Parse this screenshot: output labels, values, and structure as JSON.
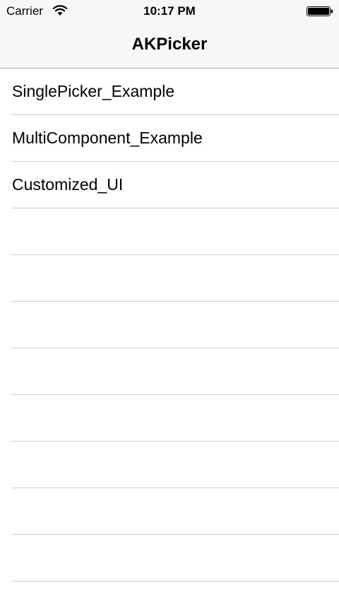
{
  "status_bar": {
    "carrier": "Carrier",
    "time": "10:17 PM",
    "wifi_icon": "wifi-icon",
    "battery_icon": "battery-icon"
  },
  "nav": {
    "title": "AKPicker"
  },
  "table": {
    "rows": [
      {
        "label": "SinglePicker_Example"
      },
      {
        "label": "MultiComponent_Example"
      },
      {
        "label": "Customized_UI"
      },
      {
        "label": ""
      },
      {
        "label": ""
      },
      {
        "label": ""
      },
      {
        "label": ""
      },
      {
        "label": ""
      },
      {
        "label": ""
      },
      {
        "label": ""
      },
      {
        "label": ""
      },
      {
        "label": ""
      }
    ]
  },
  "colors": {
    "nav_background": "#f7f7f7",
    "separator": "#cfcfcf",
    "text": "#000000"
  }
}
